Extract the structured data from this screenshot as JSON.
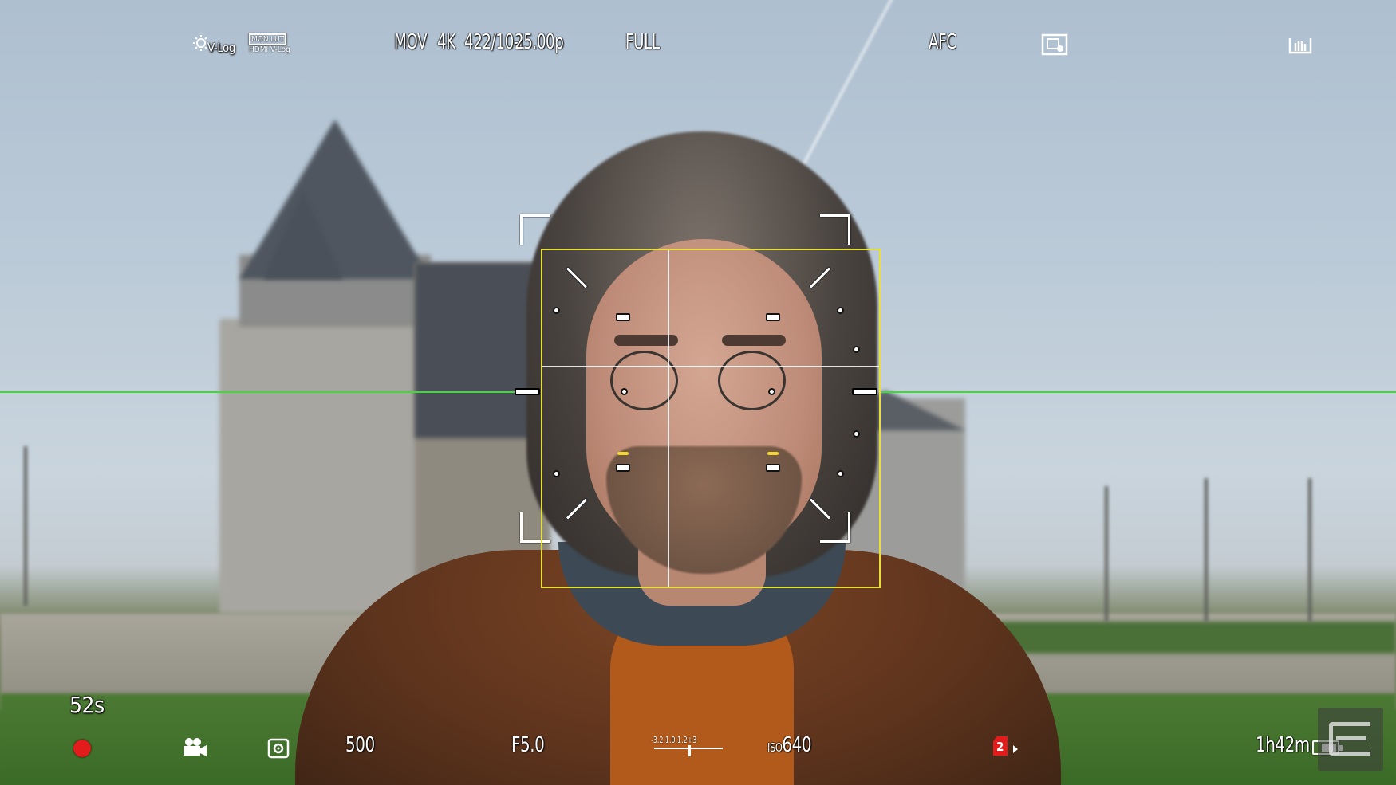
{
  "top_bar": {
    "photo_style": "V-Log",
    "lut_monitor": "MON LUT",
    "lut_hdmi": "HDMI V-Log",
    "file_format": "MOV",
    "resolution": "4K",
    "codec": "422/10-L",
    "frame_rate": "25.00p",
    "sensor_crop": "FULL",
    "af_mode": "AFC"
  },
  "bottom_bar": {
    "record_time_elapsed": "52s",
    "shutter": "500",
    "aperture": "F5.0",
    "exposure_scale": "-3.2.1.0.1.2+3",
    "iso_label": "ISO",
    "iso_value": "640",
    "card_slot": "2",
    "remaining_time": "1h42m",
    "battery_level": 0.7
  },
  "icons": {
    "photo_style": "v-log-icon",
    "af_detect": "subject-detect-icon",
    "stabilizer": "image-stabilizer-icon",
    "record": "record-indicator-icon",
    "movie_mode": "movie-camera-icon",
    "metering": "metering-icon",
    "watermark": "engadget-logo-icon"
  },
  "colors": {
    "af_box": "#e8e036",
    "level_gauge": "#36e12a",
    "record": "#e21b1b"
  }
}
